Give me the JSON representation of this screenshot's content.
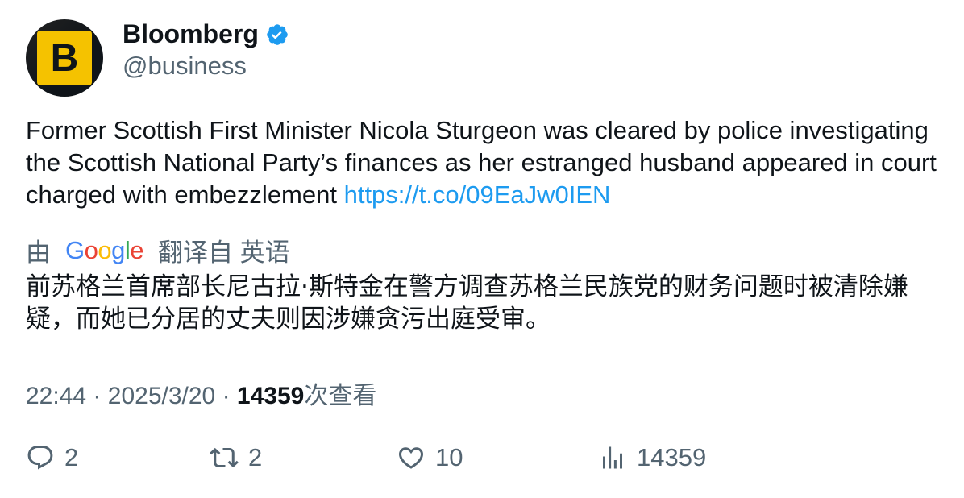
{
  "author": {
    "display_name": "Bloomberg",
    "handle": "@business",
    "avatar_letter": "B",
    "verified_icon": "verified-badge-icon"
  },
  "tweet": {
    "text": "Former Scottish First Minister Nicola Sturgeon was cleared by police investigating the Scottish National Party’s finances as her estranged husband appeared in court charged with embezzlement ",
    "link": "https://t.co/09EaJw0IEN"
  },
  "translation": {
    "prefix": "由",
    "google_letters": [
      "G",
      "o",
      "o",
      "g",
      "l",
      "e"
    ],
    "suffix": "翻译自 英语",
    "text": "前苏格兰首席部长尼古拉·斯特金在警方调查苏格兰民族党的财务问题时被清除嫌疑，而她已分居的丈夫则因涉嫌贪污出庭受审。"
  },
  "meta": {
    "time": "22:44",
    "separator": "·",
    "date": "2025/3/20",
    "views_count": "14359",
    "views_label": "次查看"
  },
  "actions": {
    "replies": "2",
    "retweets": "2",
    "likes": "10",
    "views": "14359"
  },
  "colors": {
    "link": "#1d9bf0",
    "secondary_text": "#536471",
    "avatar_yellow": "#f5c200"
  }
}
